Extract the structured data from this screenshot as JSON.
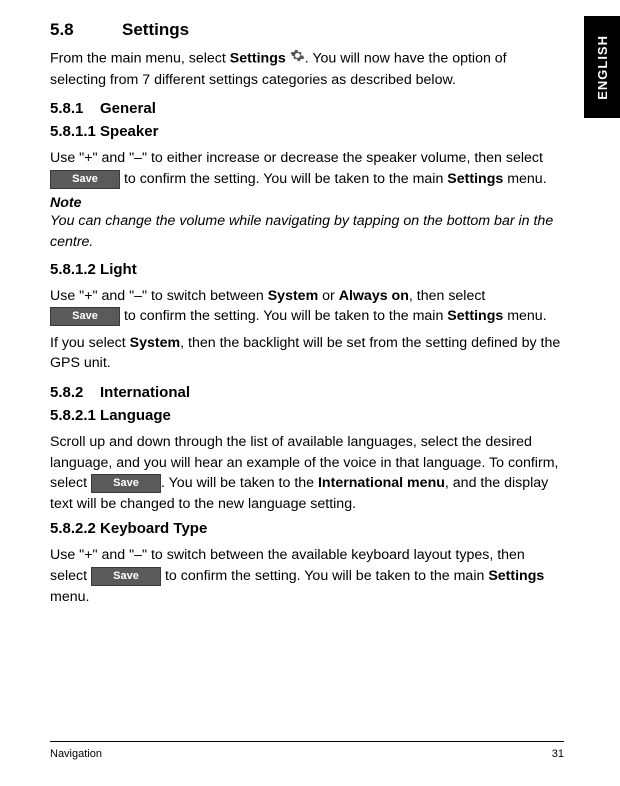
{
  "sideTab": "ENGLISH",
  "h58": {
    "num": "5.8",
    "title": "Settings"
  },
  "intro1": "From the main menu, select ",
  "intro1b": "Settings",
  "intro2": ". You will now have the option of selecting from 7 different settings categories as described below.",
  "h581": {
    "num": "5.8.1",
    "title": "General"
  },
  "h5811": "5.8.1.1 Speaker",
  "speaker1": "Use \"+\" and \"–\" to either increase or decrease the speaker volume, then select ",
  "speaker2": " to confirm the setting. You will be taken to the main ",
  "speaker2b": "Settings",
  "speaker3": " menu.",
  "noteLabel": "Note",
  "noteText": "You can change the volume while navigating by tapping on the bottom bar in the centre.",
  "h5812": "5.8.1.2 Light",
  "light1": "Use \"+\" and \"–\" to switch between ",
  "light1b": "System",
  "light1c": " or ",
  "light1d": "Always on",
  "light1e": ", then select ",
  "light2": " to confirm the setting. You will be taken to the main ",
  "light2b": "Settings",
  "light2c": " menu.",
  "light3a": "If you select ",
  "light3b": "System",
  "light3c": ", then the backlight will be set from the setting defined by the GPS unit.",
  "h582": {
    "num": "5.8.2",
    "title": "International"
  },
  "h5821": "5.8.2.1 Language",
  "lang1": "Scroll up and down through the list of available languages, select the desired language, and you will hear an example of the voice in that language. To confirm, select ",
  "lang2": ". You will be taken to the ",
  "lang2b": "International menu",
  "lang2c": ", and the display text will be changed to the new language setting.",
  "h5822": "5.8.2.2 Keyboard Type",
  "kb1": "Use \"+\" and \"–\" to switch between the available keyboard layout types, then select ",
  "kb2": " to confirm the setting. You will be taken to the main ",
  "kb2b": "Settings",
  "kb2c": " menu.",
  "save": "Save",
  "footerLeft": "Navigation",
  "footerRight": "31"
}
